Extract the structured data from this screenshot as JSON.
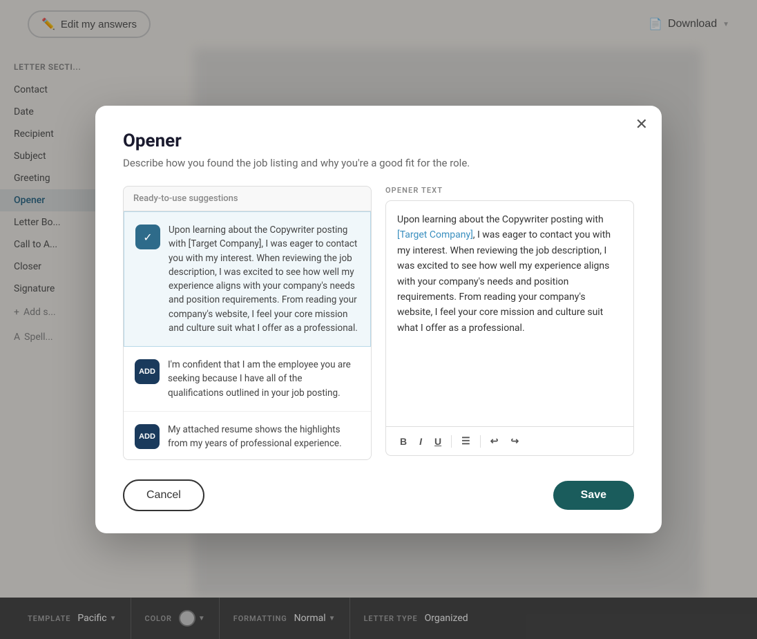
{
  "topBar": {
    "editButton": "Edit my answers",
    "downloadButton": "Download"
  },
  "sidebar": {
    "sectionTitle": "Letter secti...",
    "items": [
      {
        "label": "Contact"
      },
      {
        "label": "Date"
      },
      {
        "label": "Recipient"
      },
      {
        "label": "Subject"
      },
      {
        "label": "Greeting"
      },
      {
        "label": "Opener",
        "active": true
      },
      {
        "label": "Letter Bo..."
      },
      {
        "label": "Call to A..."
      },
      {
        "label": "Closer"
      },
      {
        "label": "Signature"
      }
    ],
    "addSection": "+ Add s...",
    "spellCheck": "Spell..."
  },
  "modal": {
    "title": "Opener",
    "subtitle": "Describe how you found the job listing and why you're a good fit for the role.",
    "suggestionsLabel": "Ready-to-use suggestions",
    "suggestions": [
      {
        "id": 1,
        "type": "selected",
        "text": "Upon learning about the Copywriter posting with [Target Company], I was eager to contact you with my interest. When reviewing the job description, I was excited to see how well my experience aligns with your company's needs and position requirements. From reading your company's website, I feel your core mission and culture suit what I offer as a professional."
      },
      {
        "id": 2,
        "type": "add",
        "text": "I'm confident that I am the employee you are seeking because I have all of the qualifications outlined in your job posting."
      },
      {
        "id": 3,
        "type": "add",
        "text": "My attached resume shows the highlights from my years of professional experience."
      }
    ],
    "editorLabel": "OPENER TEXT",
    "editorContent": {
      "before": "Upon learning about the Copywriter posting with ",
      "highlight": "[Target Company]",
      "after": ", I was eager to contact you with my interest. When reviewing the job description, I was excited to see how well my experience aligns with your company's needs and position requirements. From reading your company's website, I feel your core mission and culture suit what I offer as a professional."
    },
    "toolbar": {
      "bold": "B",
      "italic": "I",
      "underline": "U",
      "list": "≡",
      "undo": "↩",
      "redo": "↪"
    },
    "cancelButton": "Cancel",
    "saveButton": "Save"
  },
  "bottomBar": {
    "sections": [
      {
        "label": "TEMPLATE",
        "value": "Pacific",
        "hasDropdown": true
      },
      {
        "label": "COLOR",
        "value": "",
        "isColor": true,
        "hasDropdown": true
      },
      {
        "label": "FORMATTING",
        "value": "Normal",
        "hasDropdown": true
      },
      {
        "label": "LETTER TYPE",
        "value": "Organized",
        "hasDropdown": false
      }
    ]
  }
}
